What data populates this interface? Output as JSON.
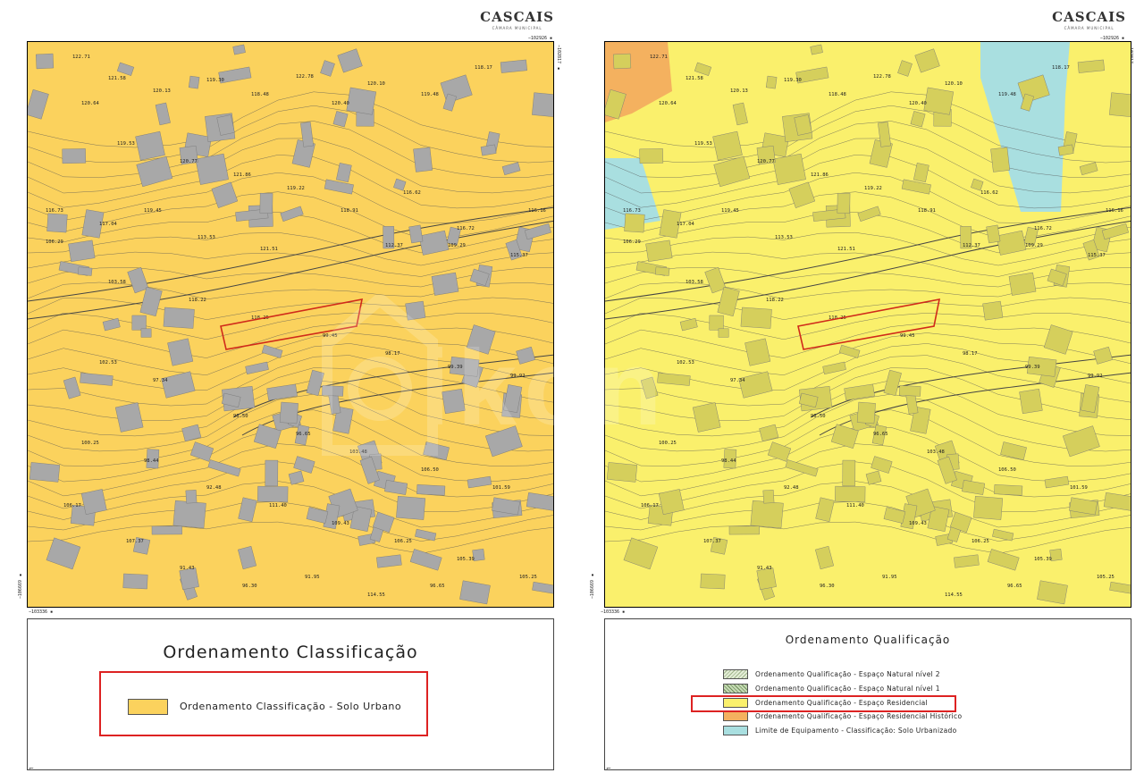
{
  "brand": {
    "name": "CASCAIS",
    "subtitle": "CÂMARA MUNICIPAL"
  },
  "coords": {
    "top": "−102926 ▪",
    "right": "−102817 ▪",
    "bottom": "−103336 ▪",
    "left": "−106669 ▪"
  },
  "colors": {
    "urban": "#fbd25d",
    "residential": "#faf06c",
    "historic": "#f4b15f",
    "equipment": "#a9dfe0",
    "building_left": "#a8a8a8",
    "building_right": "#d5cf5c",
    "plot_outline": "#d02a1a"
  },
  "left_panel": {
    "legend_title": "Ordenamento Classificação",
    "items": [
      {
        "label": "Ordenamento Classificação - Solo Urbano",
        "color": "#fbd25d"
      }
    ]
  },
  "right_panel": {
    "legend_title": "Ordenamento Qualificação",
    "items": [
      {
        "label": "Ordenamento Qualificação - Espaço Natural nível 2",
        "color": "#e3edd6"
      },
      {
        "label": "Ordenamento Qualificação - Espaço Natural nível 1",
        "color": "#c6dbb5"
      },
      {
        "label": "Ordenamento Qualificação - Espaço Residencial",
        "color": "#faf06c"
      },
      {
        "label": "Ordenamento Qualificação - Espaço Residencial Histórico",
        "color": "#f4b15f"
      },
      {
        "label": "Limite de Equipamento - Classificação: Solo Urbanizado",
        "color": "#a9dfe0"
      }
    ]
  },
  "elevations": [
    "122.71",
    "121.58",
    "120.64",
    "120.13",
    "119.30",
    "118.48",
    "122.78",
    "120.40",
    "120.10",
    "119.48",
    "118.17",
    "119.53",
    "120.77",
    "121.86",
    "119.22",
    "118.91",
    "116.62",
    "116.72",
    "116.16",
    "116.73",
    "117.04",
    "119.45",
    "113.53",
    "121.51",
    "112.37",
    "109.29",
    "115.37",
    "106.29",
    "103.58",
    "118.22",
    "118.25",
    "99.45",
    "98.17",
    "99.39",
    "99.92",
    "102.53",
    "97.34",
    "96.50",
    "96.65",
    "103.48",
    "106.50",
    "101.59",
    "100.25",
    "98.44",
    "92.48",
    "111.40",
    "109.43",
    "106.25",
    "105.39",
    "105.25",
    "106.17",
    "107.37",
    "91.43",
    "96.30",
    "91.95",
    "114.55",
    "96.65"
  ],
  "watermark": "ikon"
}
